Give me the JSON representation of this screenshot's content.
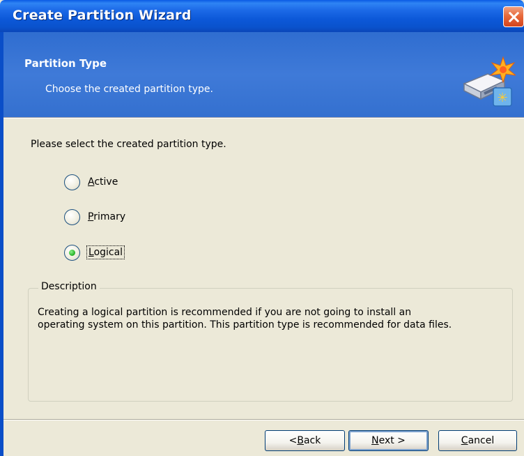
{
  "window": {
    "title": "Create Partition Wizard"
  },
  "header": {
    "title": "Partition Type",
    "subtitle": "Choose the created partition type.",
    "icon": "disk-partition-wizard-icon"
  },
  "content": {
    "prompt": "Please select the created partition type.",
    "options": [
      {
        "label": "Active",
        "accel": "A",
        "rest": "ctive",
        "selected": false
      },
      {
        "label": "Primary",
        "accel": "P",
        "rest": "rimary",
        "selected": false
      },
      {
        "label": "Logical",
        "accel": "L",
        "rest": "ogical",
        "selected": true
      }
    ]
  },
  "description": {
    "legend": "Description",
    "line1": "Creating a logical partition is recommended if you are not going to install an",
    "line2": "operating system on this partition. This partition type is recommended for data files."
  },
  "buttons": {
    "back": {
      "pre": "< ",
      "accel": "B",
      "rest": "ack"
    },
    "next": {
      "pre": "",
      "accel": "N",
      "rest": "ext >"
    },
    "cancel": {
      "pre": "",
      "accel": "C",
      "rest": "ancel"
    }
  },
  "colors": {
    "titlebar": "#0a5ae4",
    "header": "#3f7ad8",
    "dialog_bg": "#ece9d8",
    "radio_selected": "#2fb82f",
    "close_button": "#e86a3c"
  }
}
